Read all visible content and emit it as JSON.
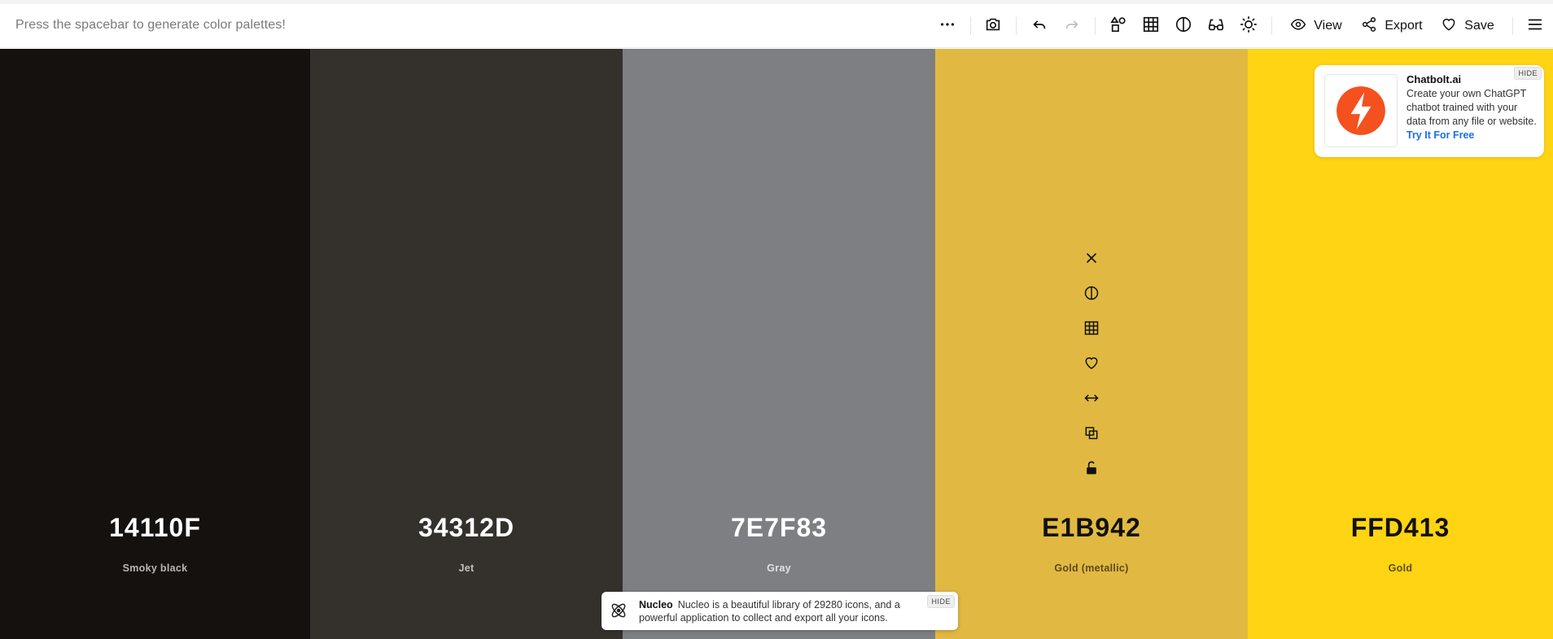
{
  "toolbar": {
    "hint": "Press the spacebar to generate color palettes!",
    "view_label": "View",
    "export_label": "Export",
    "save_label": "Save"
  },
  "palette": [
    {
      "hex": "14110F",
      "name": "Smoky black",
      "bg": "#14110f",
      "hex_color": "#ffffff",
      "name_color": "#b8b6b4"
    },
    {
      "hex": "34312D",
      "name": "Jet",
      "bg": "#34312d",
      "hex_color": "#ffffff",
      "name_color": "#c3c0bc"
    },
    {
      "hex": "7E7F83",
      "name": "Gray",
      "bg": "#7e7f83",
      "hex_color": "#ffffff",
      "name_color": "#e2e2e4"
    },
    {
      "hex": "E1B942",
      "name": "Gold (metallic)",
      "bg": "#e1b942",
      "hex_color": "#111111",
      "name_color": "#5b4a17"
    },
    {
      "hex": "FFD413",
      "name": "Gold",
      "bg": "#ffd413",
      "hex_color": "#111111",
      "name_color": "#5e4e07"
    }
  ],
  "ad": {
    "title": "Chatbolt.ai",
    "body": "Create your own ChatGPT chatbot trained with your data from any file or website.",
    "link": "Try It For Free",
    "hide": "HIDE",
    "brand_color": "#f4511e"
  },
  "toast": {
    "title": "Nucleo",
    "body": "Nucleo is a beautiful library of 29280 icons, and a powerful application to collect and export all your icons.",
    "hide": "HIDE"
  }
}
